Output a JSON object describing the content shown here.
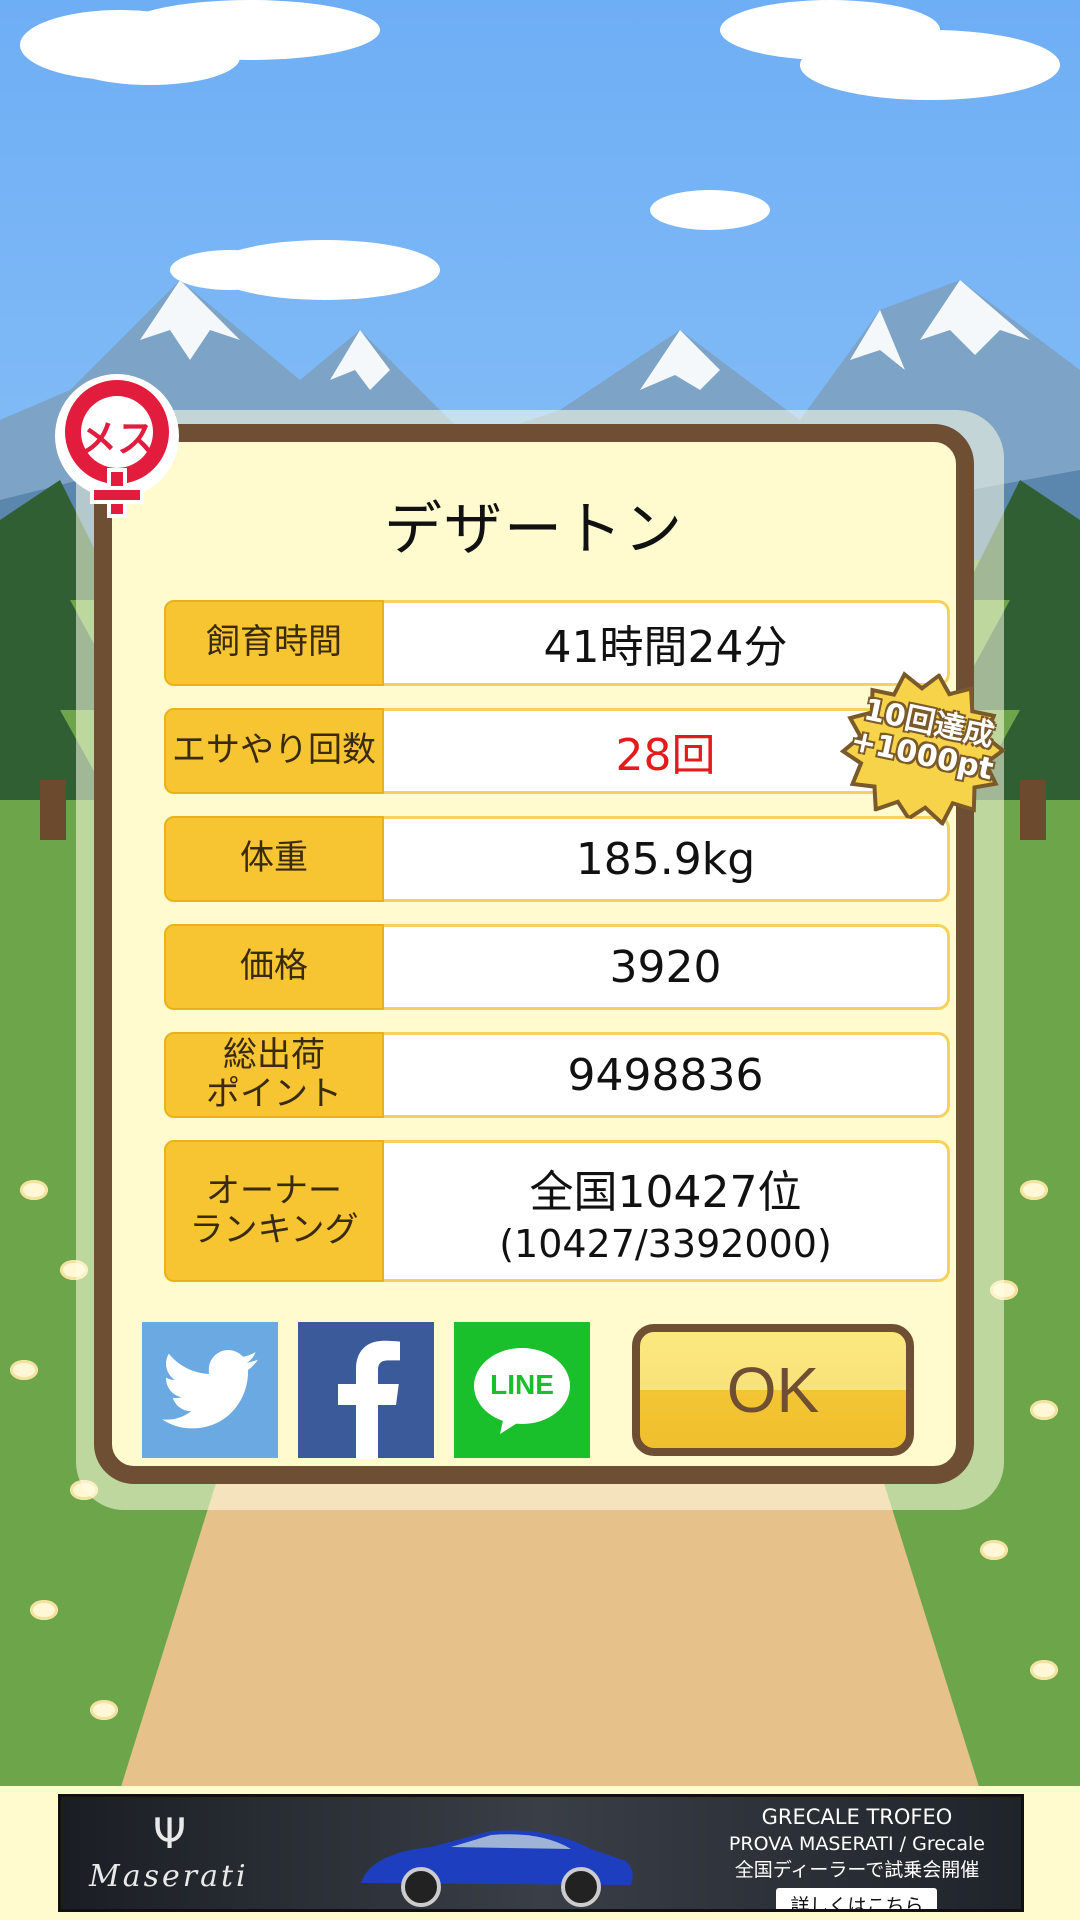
{
  "gender_label": "メス",
  "pet_name": "デザートン",
  "rows": [
    {
      "label": "飼育時間",
      "value": "41時間24分"
    },
    {
      "label": "エサやり回数",
      "value": "28回"
    },
    {
      "label": "体重",
      "value": "185.9kg"
    },
    {
      "label": "価格",
      "value": "3920"
    },
    {
      "label": "総出荷\nポイント",
      "value": "9498836"
    },
    {
      "label": "オーナー\nランキング",
      "value": "全国10427位",
      "sub": "(10427/3392000)"
    }
  ],
  "badge": {
    "line1": "10回達成",
    "line2": "+1000pt"
  },
  "share": {
    "line_label": "LINE"
  },
  "ok_label": "OK",
  "colors": {
    "frame": "#6f4f33",
    "label_bg": "#f6c531",
    "highlight_red": "#e51b1b"
  },
  "ad": {
    "brand": "Maserati",
    "line1": "GRECALE TROFEO",
    "line2": "PROVA MASERATI / Grecale",
    "line3": "全国ディーラーで試乗会開催",
    "cta": "詳しくはこちら"
  }
}
